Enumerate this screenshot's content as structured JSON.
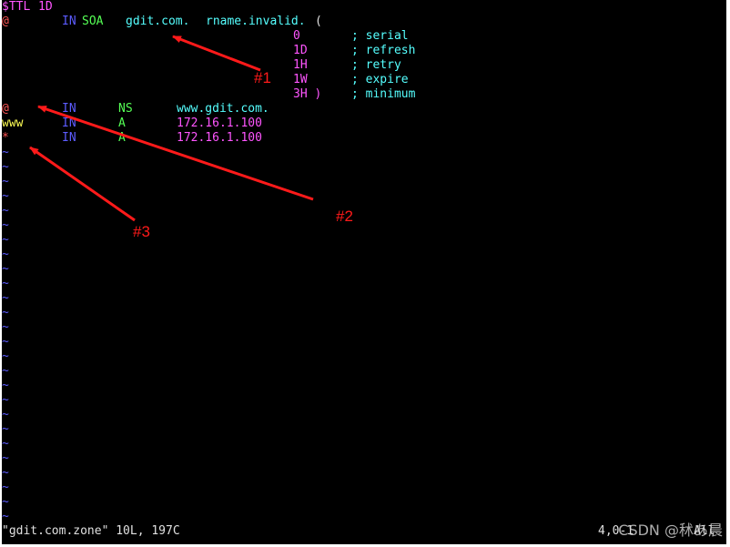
{
  "colors": {
    "background": "#000000",
    "magenta": "#ff55ff",
    "blue": "#5c5cff",
    "green": "#55ff55",
    "cyan": "#55ffff",
    "yellow": "#ffff55",
    "red": "#ff5555",
    "statusText": "#e0e0e0",
    "annotation": "#ff1a1a"
  },
  "editor": {
    "ttl_keyword": "$TTL",
    "ttl_value": "1D",
    "soa": {
      "owner": "@",
      "class": "IN",
      "type": "SOA",
      "mname": "gdit.com.",
      "rname": "rname.invalid.",
      "open_paren": "("
    },
    "soa_fields": [
      {
        "value": "0",
        "comment": "; serial"
      },
      {
        "value": "1D",
        "comment": "; refresh"
      },
      {
        "value": "1H",
        "comment": "; retry"
      },
      {
        "value": "1W",
        "comment": "; expire"
      },
      {
        "value": "3H )",
        "comment": "; minimum"
      }
    ],
    "records": [
      {
        "owner": "@",
        "class": "IN",
        "type": "NS",
        "data": "www.gdit.com."
      },
      {
        "owner": "www",
        "class": "IN",
        "type": "A",
        "data": "172.16.1.100"
      },
      {
        "owner": "*",
        "class": "IN",
        "type": "A",
        "data": "172.16.1.100"
      }
    ],
    "empty_line_marker": "~"
  },
  "status_bar": {
    "file_info": "\"gdit.com.zone\" 10L, 197C",
    "position": "4,0-1",
    "scroll": "All"
  },
  "annotations": {
    "label_1": "#1",
    "label_2": "#2",
    "label_3": "#3"
  },
  "watermark": "CSDN @秫あ晨"
}
